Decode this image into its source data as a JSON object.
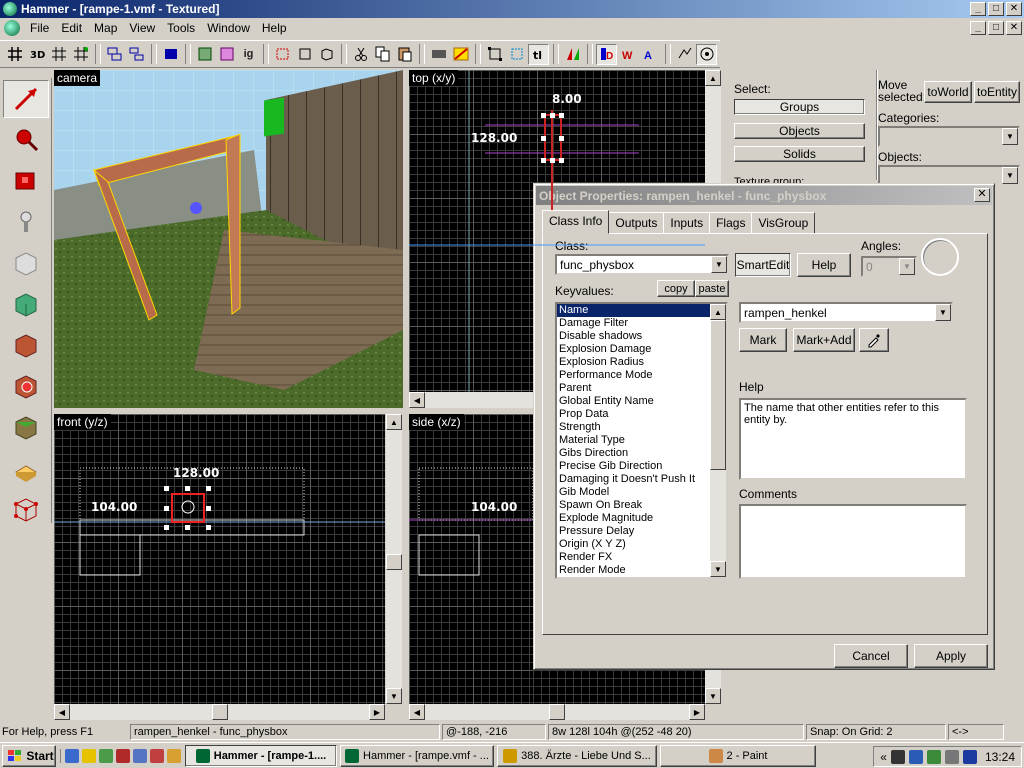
{
  "window": {
    "title": "Hammer - [rampe-1.vmf - Textured]",
    "min": "_",
    "max": "□",
    "close": "✕"
  },
  "menubar": [
    "File",
    "Edit",
    "Map",
    "View",
    "Tools",
    "Window",
    "Help"
  ],
  "toolbar": {
    "icons": [
      "grid-icon",
      "3d-grid-icon",
      "small-grid-icon",
      "large-grid-icon",
      "group-icon",
      "ungroup-icon",
      "help-icon",
      "ig-icon",
      "carve-icon",
      "hollow-icon",
      "wireframe-icon",
      "cut-icon",
      "copy-icon",
      "paste-icon",
      "texture-icon",
      "texture-lock-icon",
      "bounding-box-icon",
      "selection-icon",
      "texture-lock-2-icon",
      "flip-icon",
      "entity-icon",
      "hide-icon",
      "show-icon",
      "compile-icon",
      "run-icon"
    ],
    "ig_label": "ig"
  },
  "palette": {
    "tools": [
      "selection-tool",
      "magnify-tool",
      "camera-tool",
      "entity-tool",
      "block-tool",
      "texture-tool",
      "apply-texture-tool",
      "decal-tool",
      "overlay-tool",
      "clipping-tool",
      "vertex-tool"
    ]
  },
  "viewports": {
    "camera": "camera",
    "top": "top (x/y)",
    "front": "front (y/z)",
    "side": "side (x/z)",
    "top_dim1": "8.00",
    "top_dim2": "128.00",
    "front_dim1": "128.00",
    "front_dim2": "104.00",
    "side_dim": "104.00"
  },
  "rightpanel": {
    "select_label": "Select:",
    "groups": "Groups",
    "objects": "Objects",
    "solids": "Solids",
    "move_selected": "Move selected:",
    "to_world": "toWorld",
    "to_entity": "toEntity",
    "categories": "Categories:",
    "objects_label": "Objects:",
    "texture_group": "Texture group:"
  },
  "dialog": {
    "title": "Object Properties: rampen_henkel - func_physbox",
    "close": "✕",
    "tabs": [
      "Class Info",
      "Outputs",
      "Inputs",
      "Flags",
      "VisGroup"
    ],
    "class_label": "Class:",
    "class_value": "func_physbox",
    "smartedit": "SmartEdit",
    "help_button": "Help",
    "angles_label": "Angles:",
    "angles_value": "0",
    "keyvalues_label": "Keyvalues:",
    "copy": "copy",
    "paste": "paste",
    "keyvalues": [
      "Name",
      "Damage Filter",
      "Disable shadows",
      "Explosion Damage",
      "Explosion Radius",
      "Performance Mode",
      "Parent",
      "Global Entity Name",
      "Prop Data",
      "Strength",
      "Material Type",
      "Gibs Direction",
      "Precise Gib Direction",
      "Damaging it Doesn't Push It",
      "Gib Model",
      "Spawn On Break",
      "Explode Magnitude",
      "Pressure Delay",
      "Origin (X Y Z)",
      "Render FX",
      "Render Mode"
    ],
    "value": "rampen_henkel",
    "mark": "Mark",
    "mark_add": "Mark+Add",
    "help_label": "Help",
    "help_text": "The name that other entities refer to this entity by.",
    "comments_label": "Comments",
    "cancel": "Cancel",
    "apply": "Apply"
  },
  "statusbar": {
    "help": "For Help, press F1",
    "selection": "rampen_henkel - func_physbox",
    "coords": "@-188, -216",
    "size": "8w 128l 104h @(252 -48 20)",
    "snap": "Snap: On Grid: 2",
    "arrows": "<->"
  },
  "taskbar": {
    "start": "Start",
    "tasks": [
      "Hammer - [rampe-1....",
      "Hammer - [rampe.vmf - ...",
      "388. Ärzte - Liebe Und S...",
      "2 - Paint"
    ],
    "time": "13:24",
    "chevron": "«"
  },
  "colors": {
    "title_active": "#0a246a",
    "selection_red": "#e02020",
    "selection_yellow": "#ffd800"
  }
}
